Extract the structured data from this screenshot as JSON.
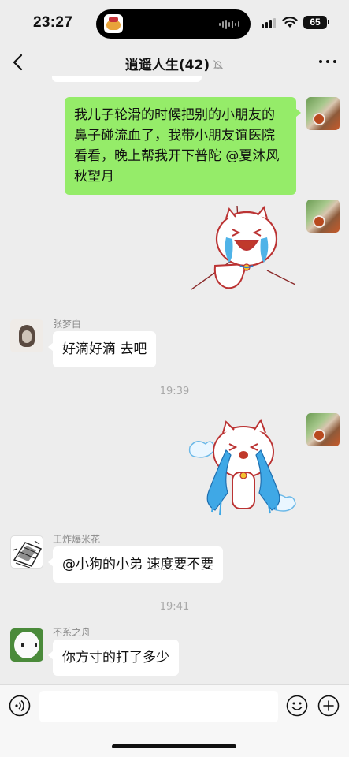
{
  "status_bar": {
    "time": "23:27",
    "battery": "65"
  },
  "header": {
    "title": "逍遥人生(42)",
    "back_icon": "chevron-left-icon",
    "mute_icon": "bell-slash-icon",
    "more_icon": "ellipsis-icon"
  },
  "messages": [
    {
      "type": "text",
      "side": "right",
      "text": "我儿子轮滑的时候把别的小朋友的鼻子碰流血了，我带小朋友谊医院看看，晚上帮我开下普陀 @夏沐风秋望月"
    },
    {
      "type": "sticker",
      "side": "right",
      "sticker": "crying-cat-sticker"
    },
    {
      "type": "text",
      "side": "left",
      "sender": "张梦白",
      "text": "好滴好滴 去吧"
    },
    {
      "type": "time",
      "text": "19:39"
    },
    {
      "type": "sticker",
      "side": "right",
      "sticker": "bawling-cat-sticker"
    },
    {
      "type": "text",
      "side": "left",
      "sender": "王炸爆米花",
      "text": "@小狗的小弟 速度要不要"
    },
    {
      "type": "time",
      "text": "19:41"
    },
    {
      "type": "text",
      "side": "left",
      "sender": "不系之舟",
      "text": "你方寸的打了多少"
    }
  ],
  "input_bar": {
    "voice_icon": "voice-icon",
    "placeholder": "",
    "emoji_icon": "emoji-icon",
    "plus_icon": "plus-icon"
  },
  "colors": {
    "background": "#ededed",
    "self_bubble": "#95ec69",
    "other_bubble": "#ffffff"
  }
}
